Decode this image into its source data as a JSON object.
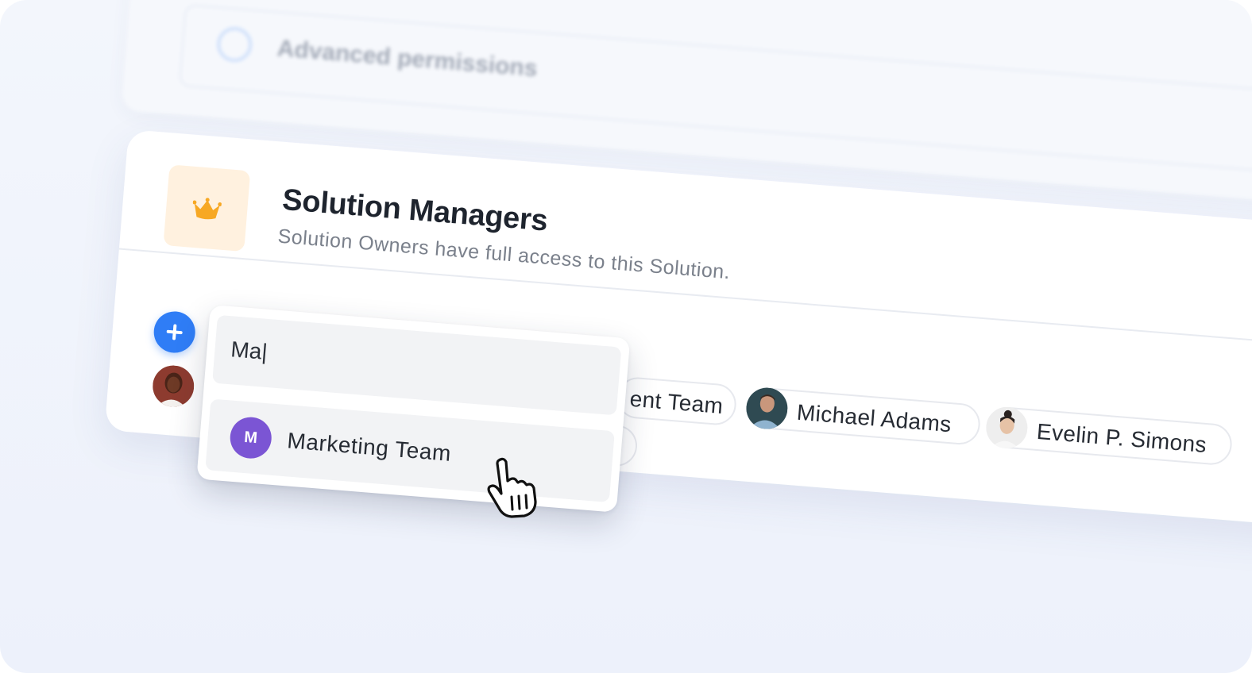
{
  "background": {
    "option_label": "Advanced permissions"
  },
  "role_card": {
    "title": "Solution Managers",
    "subtitle": "Solution Owners have full access to this Solution.",
    "icon": "crown-icon",
    "accent_color": "#f7a823"
  },
  "add_button": {
    "icon": "plus-icon",
    "color": "#2f7df6"
  },
  "members": [
    {
      "label": "ent Team"
    },
    {
      "label": "Michael Adams"
    },
    {
      "label": "Evelin P. Simons"
    }
  ],
  "search": {
    "value": "Ma|"
  },
  "results": [
    {
      "initial": "M",
      "label": "Marketing Team",
      "color": "#7b55d4"
    }
  ],
  "cursor": "hand-pointer-icon"
}
